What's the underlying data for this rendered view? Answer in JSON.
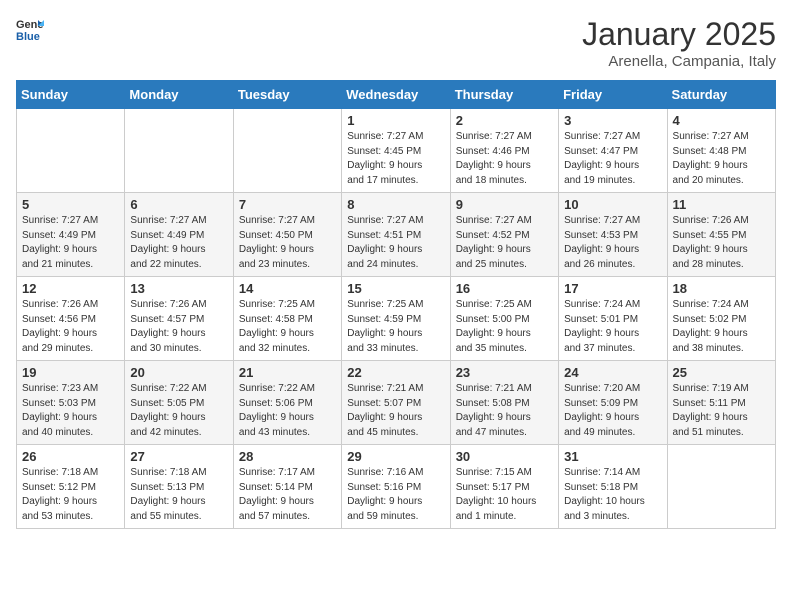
{
  "logo": {
    "general": "General",
    "blue": "Blue"
  },
  "title": "January 2025",
  "location": "Arenella, Campania, Italy",
  "weekdays": [
    "Sunday",
    "Monday",
    "Tuesday",
    "Wednesday",
    "Thursday",
    "Friday",
    "Saturday"
  ],
  "weeks": [
    [
      {
        "day": "",
        "info": ""
      },
      {
        "day": "",
        "info": ""
      },
      {
        "day": "",
        "info": ""
      },
      {
        "day": "1",
        "info": "Sunrise: 7:27 AM\nSunset: 4:45 PM\nDaylight: 9 hours\nand 17 minutes."
      },
      {
        "day": "2",
        "info": "Sunrise: 7:27 AM\nSunset: 4:46 PM\nDaylight: 9 hours\nand 18 minutes."
      },
      {
        "day": "3",
        "info": "Sunrise: 7:27 AM\nSunset: 4:47 PM\nDaylight: 9 hours\nand 19 minutes."
      },
      {
        "day": "4",
        "info": "Sunrise: 7:27 AM\nSunset: 4:48 PM\nDaylight: 9 hours\nand 20 minutes."
      }
    ],
    [
      {
        "day": "5",
        "info": "Sunrise: 7:27 AM\nSunset: 4:49 PM\nDaylight: 9 hours\nand 21 minutes."
      },
      {
        "day": "6",
        "info": "Sunrise: 7:27 AM\nSunset: 4:49 PM\nDaylight: 9 hours\nand 22 minutes."
      },
      {
        "day": "7",
        "info": "Sunrise: 7:27 AM\nSunset: 4:50 PM\nDaylight: 9 hours\nand 23 minutes."
      },
      {
        "day": "8",
        "info": "Sunrise: 7:27 AM\nSunset: 4:51 PM\nDaylight: 9 hours\nand 24 minutes."
      },
      {
        "day": "9",
        "info": "Sunrise: 7:27 AM\nSunset: 4:52 PM\nDaylight: 9 hours\nand 25 minutes."
      },
      {
        "day": "10",
        "info": "Sunrise: 7:27 AM\nSunset: 4:53 PM\nDaylight: 9 hours\nand 26 minutes."
      },
      {
        "day": "11",
        "info": "Sunrise: 7:26 AM\nSunset: 4:55 PM\nDaylight: 9 hours\nand 28 minutes."
      }
    ],
    [
      {
        "day": "12",
        "info": "Sunrise: 7:26 AM\nSunset: 4:56 PM\nDaylight: 9 hours\nand 29 minutes."
      },
      {
        "day": "13",
        "info": "Sunrise: 7:26 AM\nSunset: 4:57 PM\nDaylight: 9 hours\nand 30 minutes."
      },
      {
        "day": "14",
        "info": "Sunrise: 7:25 AM\nSunset: 4:58 PM\nDaylight: 9 hours\nand 32 minutes."
      },
      {
        "day": "15",
        "info": "Sunrise: 7:25 AM\nSunset: 4:59 PM\nDaylight: 9 hours\nand 33 minutes."
      },
      {
        "day": "16",
        "info": "Sunrise: 7:25 AM\nSunset: 5:00 PM\nDaylight: 9 hours\nand 35 minutes."
      },
      {
        "day": "17",
        "info": "Sunrise: 7:24 AM\nSunset: 5:01 PM\nDaylight: 9 hours\nand 37 minutes."
      },
      {
        "day": "18",
        "info": "Sunrise: 7:24 AM\nSunset: 5:02 PM\nDaylight: 9 hours\nand 38 minutes."
      }
    ],
    [
      {
        "day": "19",
        "info": "Sunrise: 7:23 AM\nSunset: 5:03 PM\nDaylight: 9 hours\nand 40 minutes."
      },
      {
        "day": "20",
        "info": "Sunrise: 7:22 AM\nSunset: 5:05 PM\nDaylight: 9 hours\nand 42 minutes."
      },
      {
        "day": "21",
        "info": "Sunrise: 7:22 AM\nSunset: 5:06 PM\nDaylight: 9 hours\nand 43 minutes."
      },
      {
        "day": "22",
        "info": "Sunrise: 7:21 AM\nSunset: 5:07 PM\nDaylight: 9 hours\nand 45 minutes."
      },
      {
        "day": "23",
        "info": "Sunrise: 7:21 AM\nSunset: 5:08 PM\nDaylight: 9 hours\nand 47 minutes."
      },
      {
        "day": "24",
        "info": "Sunrise: 7:20 AM\nSunset: 5:09 PM\nDaylight: 9 hours\nand 49 minutes."
      },
      {
        "day": "25",
        "info": "Sunrise: 7:19 AM\nSunset: 5:11 PM\nDaylight: 9 hours\nand 51 minutes."
      }
    ],
    [
      {
        "day": "26",
        "info": "Sunrise: 7:18 AM\nSunset: 5:12 PM\nDaylight: 9 hours\nand 53 minutes."
      },
      {
        "day": "27",
        "info": "Sunrise: 7:18 AM\nSunset: 5:13 PM\nDaylight: 9 hours\nand 55 minutes."
      },
      {
        "day": "28",
        "info": "Sunrise: 7:17 AM\nSunset: 5:14 PM\nDaylight: 9 hours\nand 57 minutes."
      },
      {
        "day": "29",
        "info": "Sunrise: 7:16 AM\nSunset: 5:16 PM\nDaylight: 9 hours\nand 59 minutes."
      },
      {
        "day": "30",
        "info": "Sunrise: 7:15 AM\nSunset: 5:17 PM\nDaylight: 10 hours\nand 1 minute."
      },
      {
        "day": "31",
        "info": "Sunrise: 7:14 AM\nSunset: 5:18 PM\nDaylight: 10 hours\nand 3 minutes."
      },
      {
        "day": "",
        "info": ""
      }
    ]
  ]
}
